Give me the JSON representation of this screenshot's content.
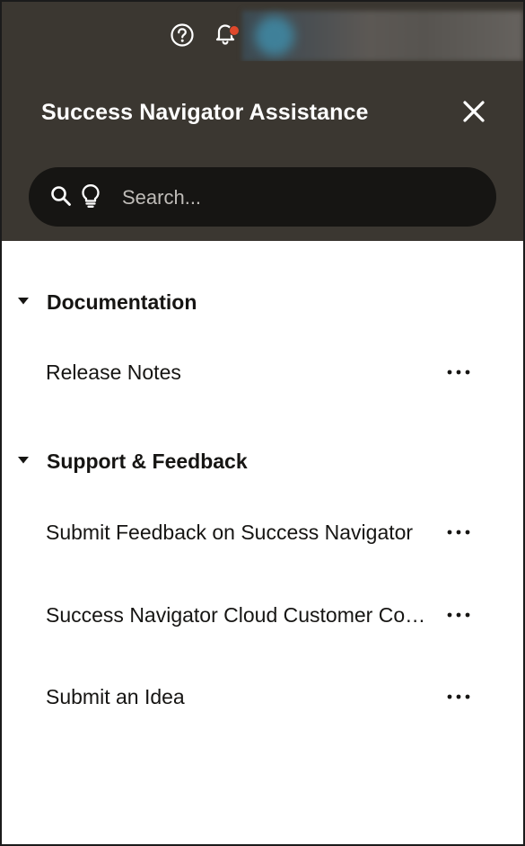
{
  "topbar": {
    "icons": [
      "help-icon",
      "bell-icon"
    ],
    "notification_color": "#e0482b"
  },
  "panel": {
    "title": "Success Navigator Assistance",
    "close_icon": "close-icon",
    "search": {
      "placeholder": "Search...",
      "value": ""
    },
    "colors": {
      "header_bg": "#3b3731",
      "search_bg": "#161513",
      "text_dark": "#161513"
    }
  },
  "sections": [
    {
      "title": "Documentation",
      "expanded": true,
      "items": [
        {
          "label": "Release Notes"
        }
      ]
    },
    {
      "title": "Support & Feedback",
      "expanded": true,
      "items": [
        {
          "label": "Submit Feedback on Success Navigator"
        },
        {
          "label": "Success Navigator Cloud Customer Connect"
        },
        {
          "label": "Submit an Idea"
        }
      ]
    }
  ]
}
